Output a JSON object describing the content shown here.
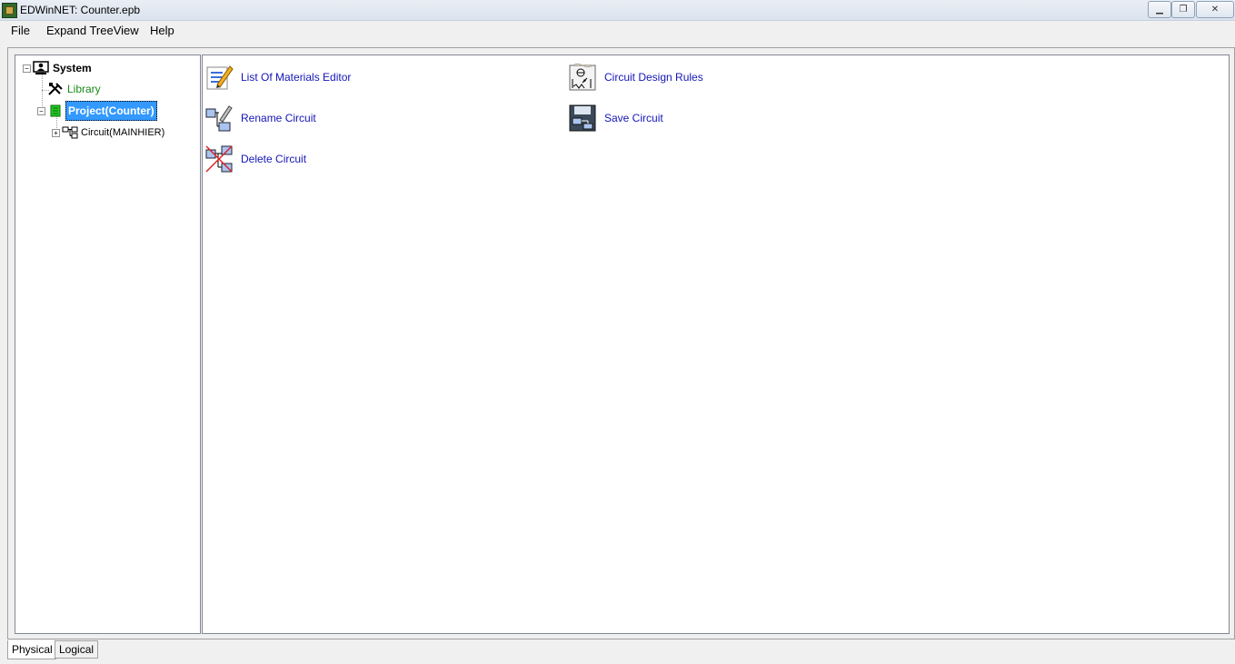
{
  "window": {
    "title": "EDWinNET: Counter.epb",
    "controls": {
      "minimize": "▁",
      "maximize": "❐",
      "close": "✕"
    }
  },
  "menu": [
    {
      "label": "File"
    },
    {
      "label": "Expand TreeView"
    },
    {
      "label": "Help"
    }
  ],
  "tree": {
    "root": {
      "label": "System",
      "expander": "−"
    },
    "library": {
      "label": "Library",
      "color": "#1a8a1a"
    },
    "project": {
      "label": "Project(Counter)",
      "expander": "−",
      "selected": true,
      "selected_bg": "#3399ff"
    },
    "circuit": {
      "label": "Circuit(MAINHIER)",
      "expander": "+"
    }
  },
  "actions": [
    {
      "label": "List Of Materials Editor",
      "icon": "list-edit-icon"
    },
    {
      "label": "Circuit Design Rules",
      "icon": "design-rules-icon"
    },
    {
      "label": "Rename Circuit",
      "icon": "rename-circuit-icon"
    },
    {
      "label": "Save Circuit",
      "icon": "save-circuit-icon"
    },
    {
      "label": "Delete Circuit",
      "icon": "delete-circuit-icon"
    }
  ],
  "tabs": [
    {
      "label": "Physical",
      "active": true
    },
    {
      "label": "Logical",
      "active": false
    }
  ],
  "colors": {
    "link": "#1515b8",
    "selection": "#3399ff"
  }
}
